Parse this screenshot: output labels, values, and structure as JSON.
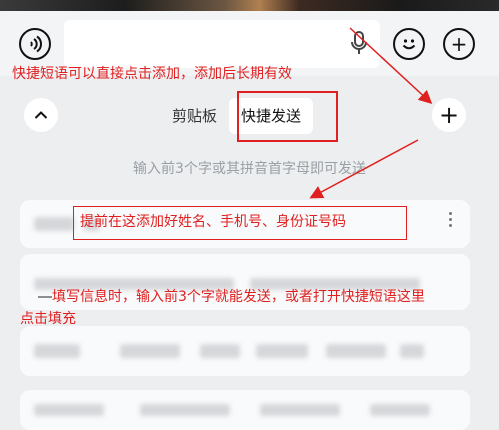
{
  "segmented": {
    "tab_clipboard": "剪贴板",
    "tab_quick_send": "快捷发送"
  },
  "hint": "输入前3个字或其拼音首字母即可发送",
  "annotations": {
    "top": "快捷短语可以直接点击添加，添加后长期有效",
    "box": "提前在这添加好姓名、手机号、身份证号码",
    "bottom_line1": "填写信息时，输入前3个字就能发送，或者打开快捷短语这里",
    "bottom_line2": "点击填充"
  },
  "icons": {
    "voice": "voice-wave-icon",
    "mic": "microphone-icon",
    "emoji": "emoji-icon",
    "plus": "plus-icon",
    "collapse": "chevron-up-icon",
    "add": "add-icon",
    "more": "more-vertical-icon"
  },
  "colors": {
    "annotation": "#e02020",
    "background": "#eceef0",
    "hint": "#9aa0a6"
  }
}
